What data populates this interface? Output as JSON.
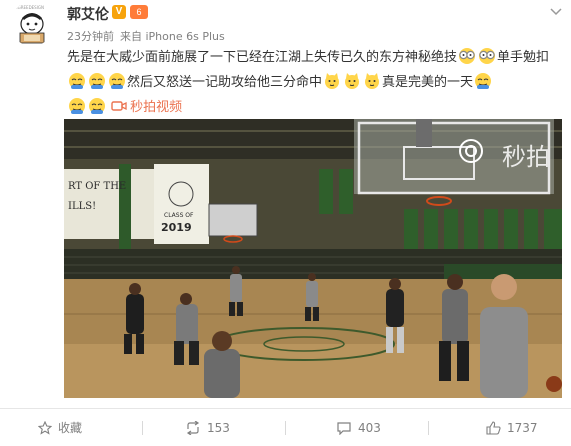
{
  "user": {
    "name": "郭艾伦",
    "verified_badge": "V",
    "level_badge": "6",
    "avatar_icon": "cartoon-avatar-icon"
  },
  "meta": {
    "time": "23分钟前",
    "source": "来自 iPhone 6s Plus"
  },
  "post": {
    "text_1": "先是在大威少面前施展了一下已经在江湖上失传已久的东方神秘绝技",
    "text_2": "单手勉扣",
    "text_3": "然后又怒送一记助攻给他三分命中",
    "text_4": "真是完美的一天",
    "video_link": "秒拍视频"
  },
  "video": {
    "watermark": "秒拍",
    "banner_text_1": "RT OF THE",
    "banner_text_2": "ILLS!",
    "banner_text_3": "CLASS OF",
    "banner_text_4": "2019"
  },
  "actions": {
    "favorite": "收藏",
    "repost": "153",
    "comment": "403",
    "like": "1737"
  },
  "colors": {
    "link": "#eb7350",
    "meta": "#808080",
    "vbadge": "#f7a30c"
  }
}
